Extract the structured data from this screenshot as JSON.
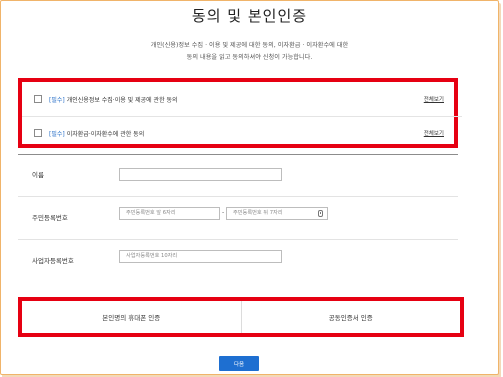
{
  "title": "동의 및 본인인증",
  "description": [
    "개인(신용)정보 수집 · 이용 및 제공에 대한 동의, 이자환급 · 이자환수에 대한",
    "동의 내용을 읽고 동의하셔야 신청이 가능합니다."
  ],
  "agreements": [
    {
      "required_tag": "[필수]",
      "label": "개인신용정보 수집·이용 및 제공에 관한 동의",
      "view_all": "전체보기",
      "checked": false
    },
    {
      "required_tag": "[필수]",
      "label": "이자환급·이자환수에 관한 동의",
      "view_all": "전체보기",
      "checked": false
    }
  ],
  "form": {
    "name": {
      "label": "이름",
      "value": ""
    },
    "resident_number": {
      "label": "주민등록번호",
      "front_placeholder": "주민등록번호 앞 6자리",
      "separator": "-",
      "back_placeholder": "주민등록번호 뒤 7자리",
      "keypad_icon": "secure-keypad-icon"
    },
    "business_number": {
      "label": "사업자등록번호",
      "placeholder": "사업자등록번호 10자리"
    }
  },
  "auth": {
    "phone_label": "본인명의 휴대폰 인증",
    "certificate_label": "공동인증서 인증"
  },
  "next_label": "다음",
  "colors": {
    "highlight": "#e60012",
    "primary_button": "#1e6fd1",
    "required_tag": "#2b72c9",
    "frame_border": "#f0b46a"
  }
}
